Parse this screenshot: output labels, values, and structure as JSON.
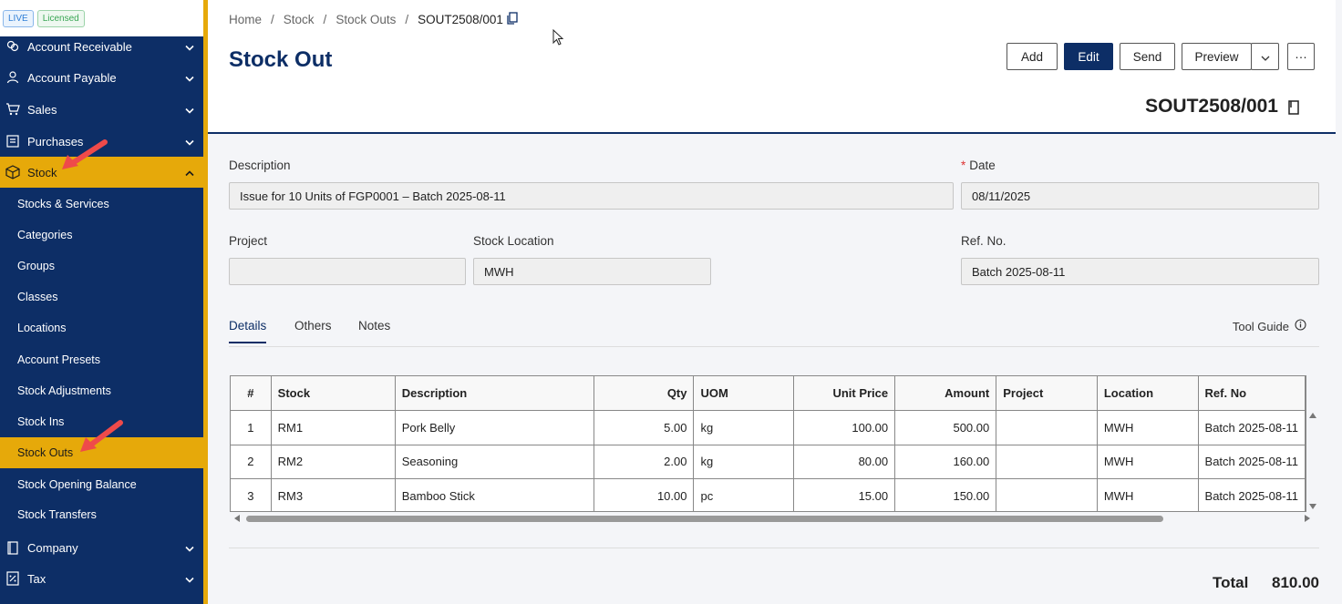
{
  "badges": {
    "live": "LIVE",
    "licensed": "Licensed"
  },
  "sidebar": {
    "menu": [
      {
        "label": "Account Receivable",
        "icon": "coins-icon"
      },
      {
        "label": "Account Payable",
        "icon": "person-icon"
      },
      {
        "label": "Sales",
        "icon": "cart-icon"
      },
      {
        "label": "Purchases",
        "icon": "receipt-icon"
      },
      {
        "label": "Stock",
        "icon": "box-icon"
      }
    ],
    "submenu": [
      "Stocks & Services",
      "Categories",
      "Groups",
      "Classes",
      "Locations",
      "Account Presets",
      "Stock Adjustments",
      "Stock Ins",
      "Stock Outs",
      "Stock Opening Balance",
      "Stock Transfers"
    ],
    "bottom": [
      {
        "label": "Company",
        "icon": "book-icon"
      },
      {
        "label": "Tax",
        "icon": "tax-icon"
      }
    ]
  },
  "breadcrumb": {
    "home": "Home",
    "stock": "Stock",
    "stock_outs": "Stock Outs",
    "current": "SOUT2508/001",
    "sep": "/"
  },
  "page": {
    "title": "Stock Out",
    "doc_no": "SOUT2508/001"
  },
  "toolbar": {
    "add": "Add",
    "edit": "Edit",
    "send": "Send",
    "preview": "Preview",
    "more": "···"
  },
  "form": {
    "description_label": "Description",
    "description": "Issue for 10 Units of FGP0001 – Batch 2025-08-11",
    "date_label": "Date",
    "date_required": "*",
    "date": "08/11/2025",
    "project_label": "Project",
    "project": "",
    "location_label": "Stock Location",
    "location": "MWH",
    "refno_label": "Ref. No.",
    "refno": "Batch 2025-08-11"
  },
  "tabs": {
    "details": "Details",
    "others": "Others",
    "notes": "Notes",
    "tool_guide": "Tool Guide"
  },
  "table": {
    "headers": [
      "#",
      "Stock",
      "Description",
      "Qty",
      "UOM",
      "Unit Price",
      "Amount",
      "Project",
      "Location",
      "Ref. No"
    ],
    "rows": [
      [
        "1",
        "RM1",
        "Pork Belly",
        "5.00",
        "kg",
        "100.00",
        "500.00",
        "",
        "MWH",
        "Batch 2025-08-11"
      ],
      [
        "2",
        "RM2",
        "Seasoning",
        "2.00",
        "kg",
        "80.00",
        "160.00",
        "",
        "MWH",
        "Batch 2025-08-11"
      ],
      [
        "3",
        "RM3",
        "Bamboo Stick",
        "10.00",
        "pc",
        "15.00",
        "150.00",
        "",
        "MWH",
        "Batch 2025-08-11"
      ]
    ]
  },
  "totals": {
    "label": "Total",
    "value": "810.00"
  },
  "colors": {
    "navy": "#0d2e66",
    "accent": "#e6a90a"
  }
}
